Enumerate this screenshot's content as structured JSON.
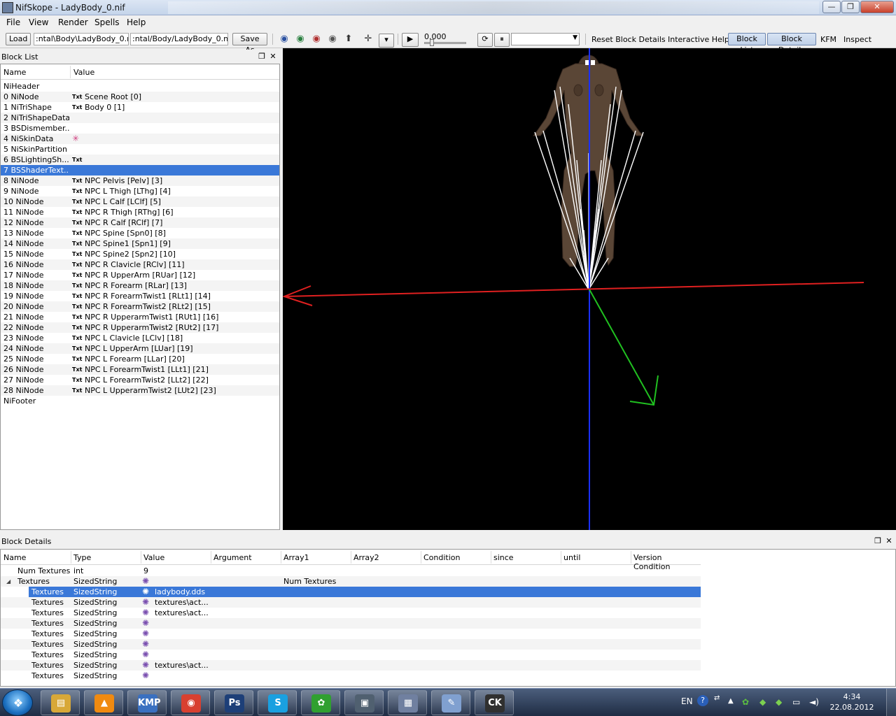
{
  "window": {
    "title": "NifSkope - LadyBody_0.nif",
    "min_label": "—",
    "max_label": "❐",
    "close_label": "✕"
  },
  "menu": {
    "items": [
      "File",
      "View",
      "Render",
      "Spells",
      "Help"
    ]
  },
  "toolbar": {
    "load_label": "Load",
    "load_path": ":ntal\\Body\\LadyBody_0.nif",
    "save_path": ":ntal/Body/LadyBody_0.nif",
    "save_as_label": "Save As",
    "time_value": "0.000",
    "reset_block_details": "Reset Block Details",
    "interactive_help": "Interactive Help",
    "block_list": "Block List",
    "block_details": "Block Details",
    "kfm": "KFM",
    "inspect": "Inspect"
  },
  "block_list": {
    "title": "Block List",
    "col_name": "Name",
    "col_value": "Value",
    "rows": [
      {
        "name": "NiHeader",
        "tag": "",
        "value": ""
      },
      {
        "name": "0 NiNode",
        "tag": "Txt",
        "value": "Scene Root [0]"
      },
      {
        "name": "1 NiTriShape",
        "tag": "Txt",
        "value": "Body 0 [1]"
      },
      {
        "name": "2 NiTriShapeData",
        "tag": "",
        "value": ""
      },
      {
        "name": "3 BSDismember...",
        "tag": "",
        "value": ""
      },
      {
        "name": "4 NiSkinData",
        "tag": "✳",
        "value": ""
      },
      {
        "name": "5 NiSkinPartition",
        "tag": "",
        "value": ""
      },
      {
        "name": "6 BSLightingSh...",
        "tag": "Txt",
        "value": ""
      },
      {
        "name": "7 BSShaderText...",
        "tag": "",
        "value": "",
        "selected": true
      },
      {
        "name": "8 NiNode",
        "tag": "Txt",
        "value": "NPC Pelvis [Pelv] [3]"
      },
      {
        "name": "9 NiNode",
        "tag": "Txt",
        "value": "NPC L Thigh [LThg] [4]"
      },
      {
        "name": "10 NiNode",
        "tag": "Txt",
        "value": "NPC L Calf [LClf] [5]"
      },
      {
        "name": "11 NiNode",
        "tag": "Txt",
        "value": "NPC R Thigh [RThg] [6]"
      },
      {
        "name": "12 NiNode",
        "tag": "Txt",
        "value": "NPC R Calf [RClf] [7]"
      },
      {
        "name": "13 NiNode",
        "tag": "Txt",
        "value": "NPC Spine [Spn0] [8]"
      },
      {
        "name": "14 NiNode",
        "tag": "Txt",
        "value": "NPC Spine1 [Spn1] [9]"
      },
      {
        "name": "15 NiNode",
        "tag": "Txt",
        "value": "NPC Spine2 [Spn2] [10]"
      },
      {
        "name": "16 NiNode",
        "tag": "Txt",
        "value": "NPC R Clavicle [RClv] [11]"
      },
      {
        "name": "17 NiNode",
        "tag": "Txt",
        "value": "NPC R UpperArm [RUar] [12]"
      },
      {
        "name": "18 NiNode",
        "tag": "Txt",
        "value": "NPC R Forearm [RLar] [13]"
      },
      {
        "name": "19 NiNode",
        "tag": "Txt",
        "value": "NPC R ForearmTwist1 [RLt1] [14]"
      },
      {
        "name": "20 NiNode",
        "tag": "Txt",
        "value": "NPC R ForearmTwist2 [RLt2] [15]"
      },
      {
        "name": "21 NiNode",
        "tag": "Txt",
        "value": "NPC R UpperarmTwist1 [RUt1] [16]"
      },
      {
        "name": "22 NiNode",
        "tag": "Txt",
        "value": "NPC R UpperarmTwist2 [RUt2] [17]"
      },
      {
        "name": "23 NiNode",
        "tag": "Txt",
        "value": "NPC L Clavicle [LClv] [18]"
      },
      {
        "name": "24 NiNode",
        "tag": "Txt",
        "value": "NPC L UpperArm [LUar] [19]"
      },
      {
        "name": "25 NiNode",
        "tag": "Txt",
        "value": "NPC L Forearm [LLar] [20]"
      },
      {
        "name": "26 NiNode",
        "tag": "Txt",
        "value": "NPC L ForearmTwist1 [LLt1] [21]"
      },
      {
        "name": "27 NiNode",
        "tag": "Txt",
        "value": "NPC L ForearmTwist2 [LLt2] [22]"
      },
      {
        "name": "28 NiNode",
        "tag": "Txt",
        "value": "NPC L UpperarmTwist2 [LUt2] [23]"
      },
      {
        "name": "NiFooter",
        "tag": "",
        "value": ""
      }
    ]
  },
  "block_details": {
    "title": "Block Details",
    "columns": [
      "Name",
      "Type",
      "Value",
      "Argument",
      "Array1",
      "Array2",
      "Condition",
      "since",
      "until",
      "Version Condition"
    ],
    "rows": [
      {
        "name": "Num Textures",
        "type": "int",
        "value": "9",
        "icon": false,
        "array1": "",
        "indent": 1
      },
      {
        "name": "Textures",
        "type": "SizedString",
        "value": "",
        "icon": true,
        "array1": "Num Textures",
        "indent": 0,
        "twisty": "◢"
      },
      {
        "name": "Textures",
        "type": "SizedString",
        "value": "ladybody.dds",
        "icon": true,
        "array1": "",
        "indent": 2,
        "selected": true
      },
      {
        "name": "Textures",
        "type": "SizedString",
        "value": "textures\\act...",
        "icon": true,
        "array1": "",
        "indent": 2
      },
      {
        "name": "Textures",
        "type": "SizedString",
        "value": "textures\\act...",
        "icon": true,
        "array1": "",
        "indent": 2
      },
      {
        "name": "Textures",
        "type": "SizedString",
        "value": "",
        "icon": true,
        "array1": "",
        "indent": 2
      },
      {
        "name": "Textures",
        "type": "SizedString",
        "value": "",
        "icon": true,
        "array1": "",
        "indent": 2
      },
      {
        "name": "Textures",
        "type": "SizedString",
        "value": "",
        "icon": true,
        "array1": "",
        "indent": 2
      },
      {
        "name": "Textures",
        "type": "SizedString",
        "value": "",
        "icon": true,
        "array1": "",
        "indent": 2
      },
      {
        "name": "Textures",
        "type": "SizedString",
        "value": "textures\\act...",
        "icon": true,
        "array1": "",
        "indent": 2
      },
      {
        "name": "Textures",
        "type": "SizedString",
        "value": "",
        "icon": true,
        "array1": "",
        "indent": 2
      }
    ]
  },
  "taskbar": {
    "apps": [
      {
        "name": "explorer",
        "glyph": "▤",
        "color": "#d8a838"
      },
      {
        "name": "vlc",
        "glyph": "▲",
        "color": "#f08a10"
      },
      {
        "name": "kmplayer",
        "glyph": "KMP",
        "color": "#3a70c0"
      },
      {
        "name": "chrome",
        "glyph": "◉",
        "color": "#d84030"
      },
      {
        "name": "photoshop",
        "glyph": "Ps",
        "color": "#1d3f78"
      },
      {
        "name": "skype",
        "glyph": "S",
        "color": "#1aa0e0"
      },
      {
        "name": "icq",
        "glyph": "✿",
        "color": "#30a030"
      },
      {
        "name": "monitor",
        "glyph": "▣",
        "color": "#506070"
      },
      {
        "name": "nifskope",
        "glyph": "▦",
        "color": "#7080a0"
      },
      {
        "name": "paint",
        "glyph": "✎",
        "color": "#80a0d0"
      },
      {
        "name": "creation-kit",
        "glyph": "CK",
        "color": "#303030"
      }
    ],
    "language": "EN",
    "time": "4:34",
    "date": "22.08.2012"
  }
}
